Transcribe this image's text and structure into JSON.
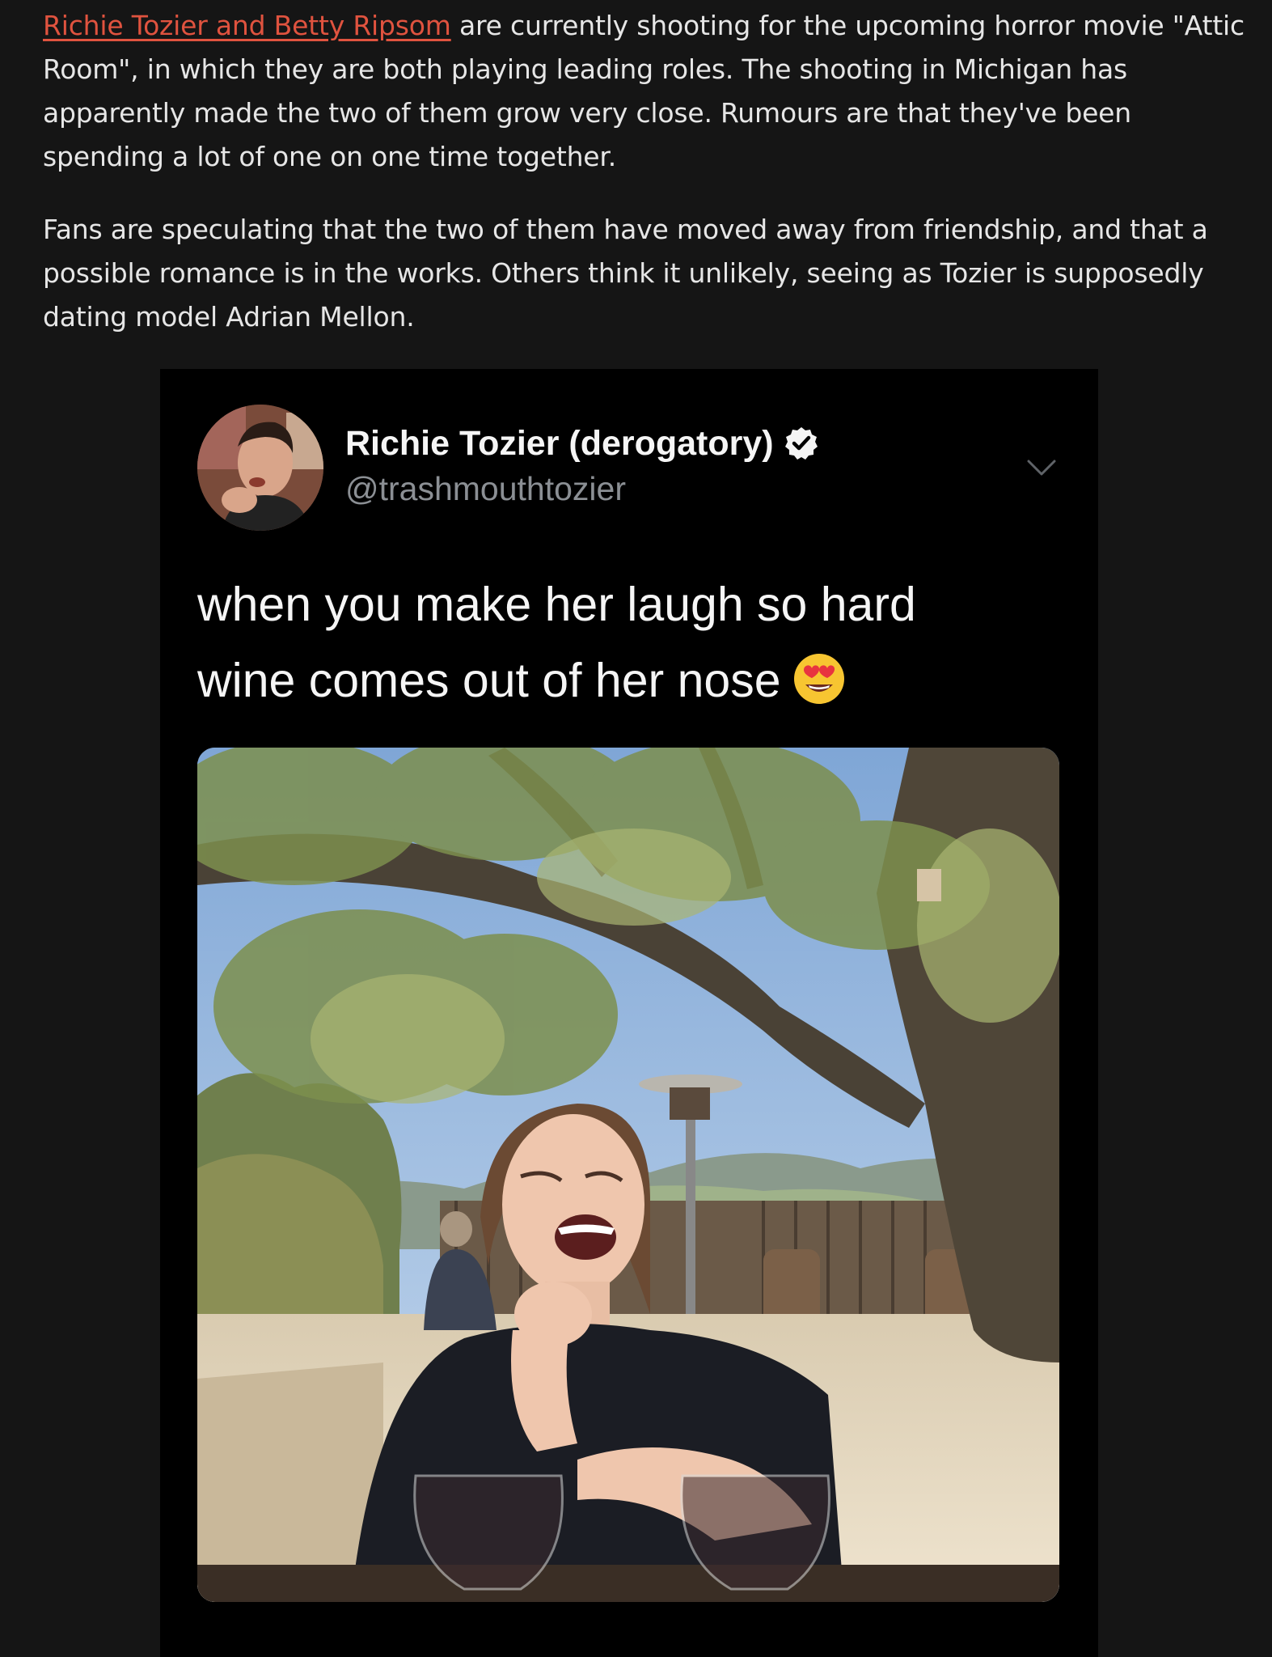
{
  "article": {
    "link_text": "Richie Tozier and Betty Ripsom",
    "para1_rest": " are currently shooting for the upcoming horror movie \"Attic Room\", in which they are both playing leading roles. The shooting in Michigan has apparently made the two of them grow very close. Rumours are that they've been spending a lot of one on one time together.",
    "para2": "Fans are speculating that the two of them have moved away from friendship, and that a possible romance is in the works. Others think it unlikely, seeing as Tozier is supposedly dating model Adrian Mellon.",
    "link_color": "#e0533f"
  },
  "tweet": {
    "display_name": "Richie Tozier (derogatory)",
    "handle": "@trashmouthtozier",
    "verified": true,
    "text_line1": "when you make her laugh so hard",
    "text_line2": "wine comes out of her nose",
    "emoji": "smiling-face-with-heart-eyes",
    "menu_icon": "chevron-down-icon",
    "background": "#000000"
  }
}
